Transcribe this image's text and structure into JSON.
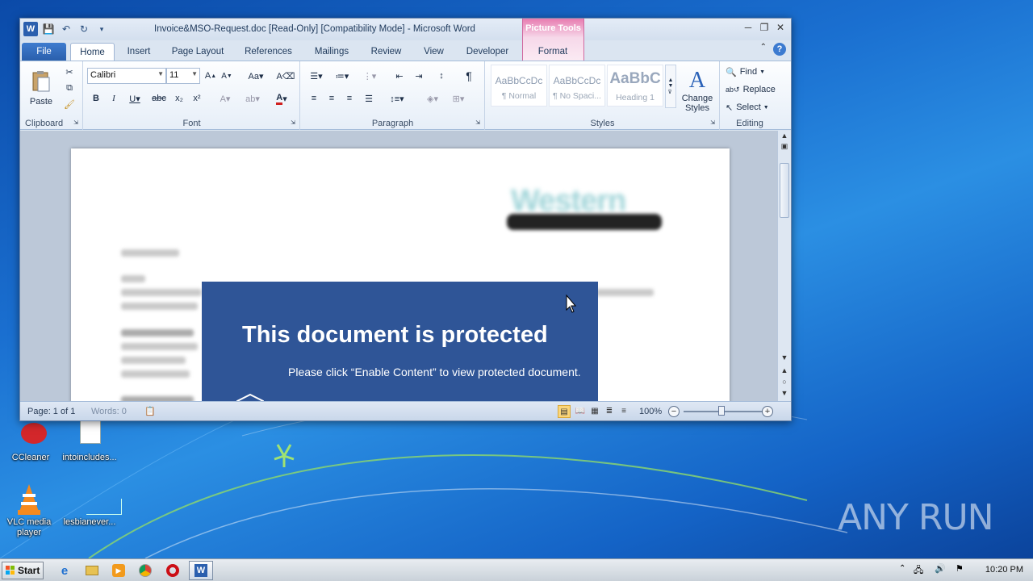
{
  "desktop": {
    "icons": [
      {
        "label": "CCleaner"
      },
      {
        "label": "intoincludes..."
      },
      {
        "label": "VLC media player"
      },
      {
        "label": "lesbianever..."
      }
    ],
    "watermark": "ANY RUN"
  },
  "window": {
    "title": "Invoice&MSO-Request.doc [Read-Only] [Compatibility Mode]  -  Microsoft Word",
    "contextual_group": "Picture Tools",
    "tabs": [
      "File",
      "Home",
      "Insert",
      "Page Layout",
      "References",
      "Mailings",
      "Review",
      "View",
      "Developer",
      "Format"
    ],
    "active_tab": "Home"
  },
  "ribbon": {
    "clipboard": {
      "label": "Clipboard",
      "paste": "Paste"
    },
    "font": {
      "label": "Font",
      "font_name": "Calibri",
      "font_size": "11"
    },
    "paragraph": {
      "label": "Paragraph"
    },
    "styles": {
      "label": "Styles",
      "items": [
        {
          "sample": "AaBbCcDc",
          "name": "¶ Normal"
        },
        {
          "sample": "AaBbCcDc",
          "name": "¶ No Spaci..."
        },
        {
          "sample": "AaBbC",
          "name": "Heading 1"
        }
      ],
      "change_styles": "Change Styles"
    },
    "editing": {
      "label": "Editing",
      "find": "Find",
      "replace": "Replace",
      "select": "Select"
    }
  },
  "document": {
    "logo_text": "Western",
    "overlay_title": "This document is protected",
    "overlay_subtitle": "Please click “Enable Content” to view protected document."
  },
  "status": {
    "page": "Page: 1 of 1",
    "words": "Words: 0",
    "zoom": "100%",
    "zoom_level": 1.0
  },
  "taskbar": {
    "start": "Start",
    "time": "10:20 PM"
  },
  "colors": {
    "overlay_bg": "#2f5597",
    "file_tab": "#2a5fac",
    "picture_tools": "#e77bb0"
  }
}
